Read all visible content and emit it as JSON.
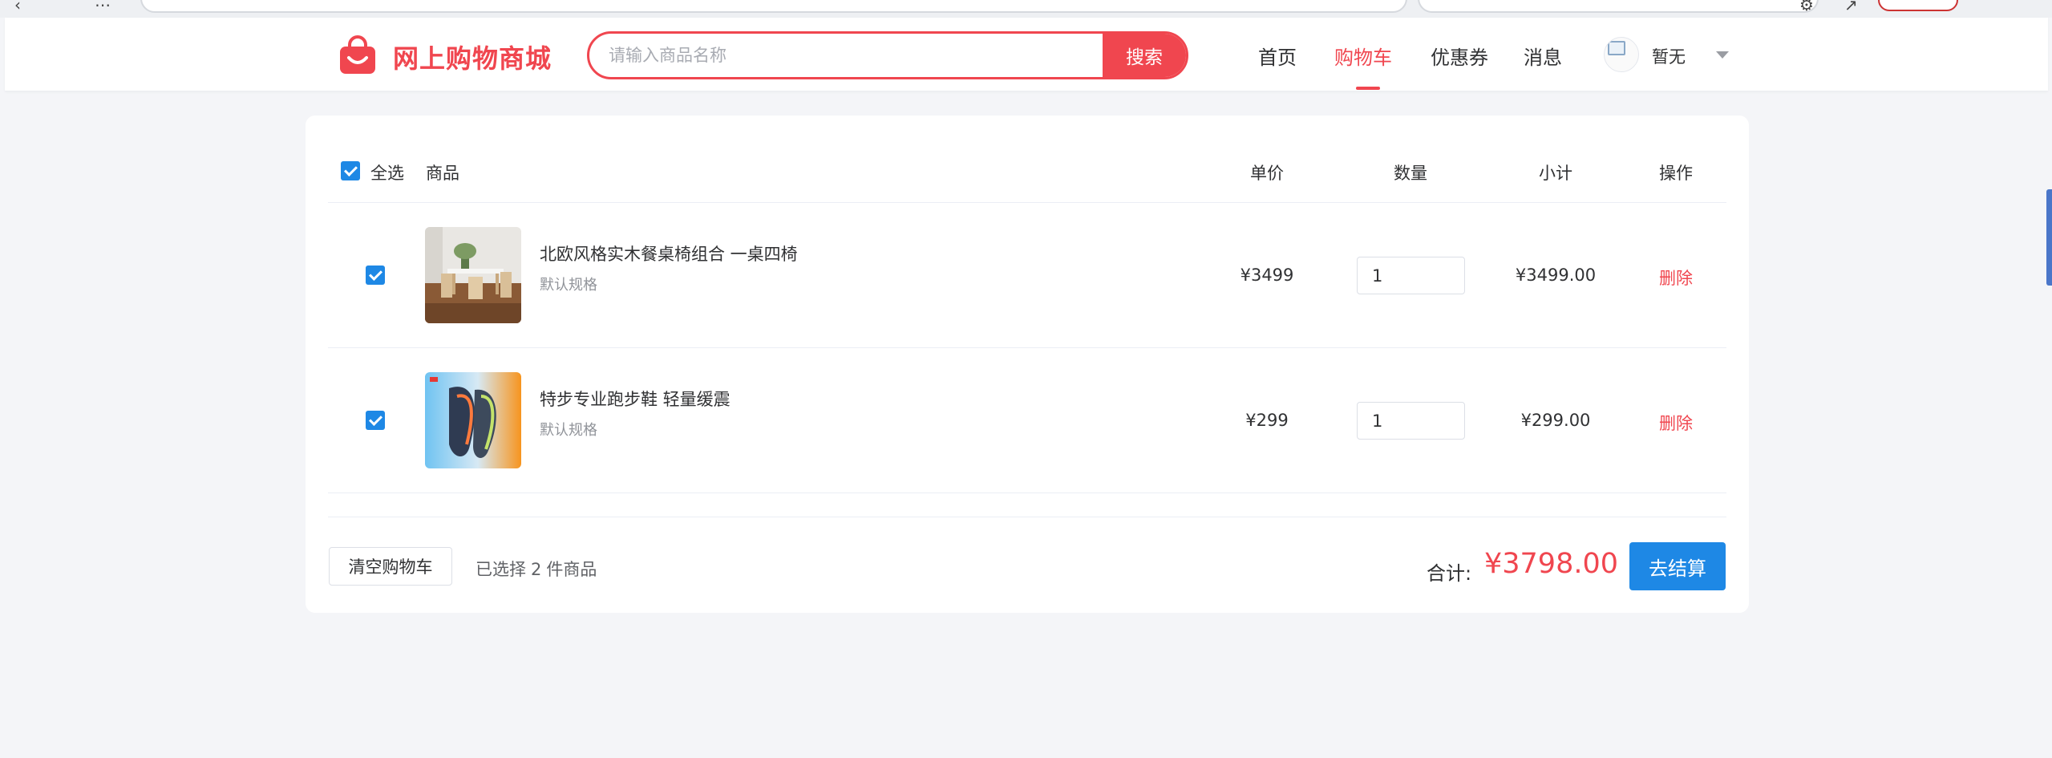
{
  "header": {
    "logo_text": "网上购物商城",
    "search": {
      "placeholder": "请输入商品名称",
      "value": "",
      "button_label": "搜索"
    },
    "nav": [
      {
        "label": "首页",
        "active": false
      },
      {
        "label": "购物车",
        "active": true
      },
      {
        "label": "优惠券",
        "active": false
      },
      {
        "label": "消息",
        "active": false
      }
    ],
    "user": {
      "name": "暂无"
    }
  },
  "cart": {
    "columns": {
      "select_all": "全选",
      "product": "商品",
      "unit_price": "单价",
      "quantity": "数量",
      "subtotal": "小计",
      "action": "操作"
    },
    "items": [
      {
        "name": "北欧风格实木餐桌椅组合 一桌四椅",
        "spec": "默认规格",
        "price": "¥3499",
        "quantity": "1",
        "subtotal": "¥3499.00",
        "action": "删除",
        "checked": true
      },
      {
        "name": "特步专业跑步鞋 轻量缓震",
        "spec": "默认规格",
        "price": "¥299",
        "quantity": "1",
        "subtotal": "¥299.00",
        "action": "删除",
        "checked": true
      }
    ],
    "footer": {
      "clear_label": "清空购物车",
      "selected_prefix": "已选择",
      "selected_count": "2",
      "selected_suffix": "件商品",
      "total_label": "合计:",
      "total_amount": "¥3798.00",
      "checkout_label": "去结算"
    }
  },
  "colors": {
    "brand": "#f0464f",
    "primary": "#1e88e5",
    "background": "#f4f5f8"
  }
}
